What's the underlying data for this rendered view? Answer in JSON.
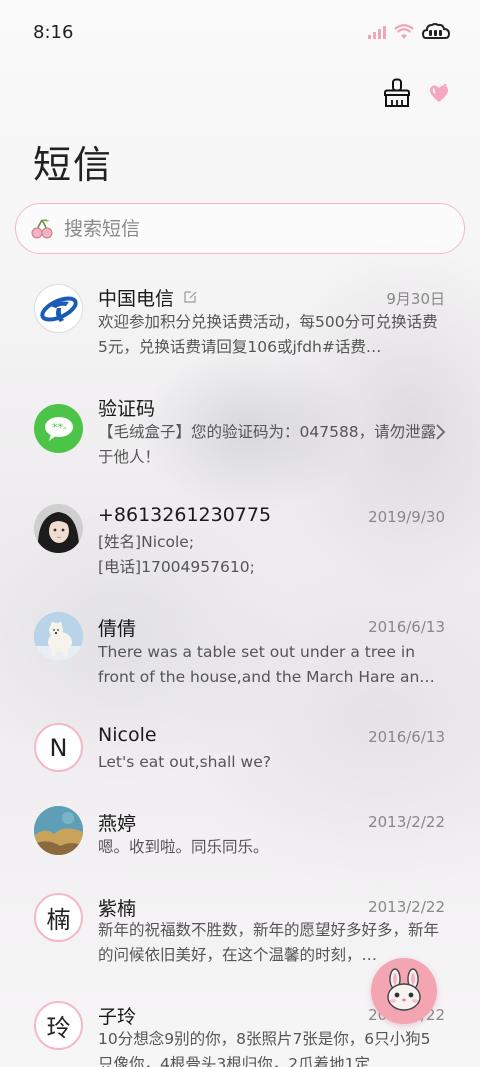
{
  "status_bar": {
    "time": "8:16",
    "accent": "#f2a6b4",
    "icons": [
      "signal-icon",
      "wifi-icon",
      "battery-icon"
    ]
  },
  "header": {
    "title": "短信",
    "actions": [
      "brush-icon",
      "heart-icon"
    ]
  },
  "search": {
    "placeholder": "搜索短信",
    "icon": "cherry-icon"
  },
  "conversations": [
    {
      "name": "中国电信",
      "date": "9月30日",
      "preview": "欢迎参加积分兑换话费活动，每500分可兑换话费5元，兑换话费请回复106或jfdh#话费…",
      "avatar": "china-telecom-logo",
      "badge": "edit-icon"
    },
    {
      "name": "验证码",
      "date": "",
      "preview": "【毛绒盒子】您的验证码为：047588，请勿泄露于他人！",
      "avatar": "message-bubble-icon"
    },
    {
      "name": "+8613261230775",
      "date": "2019/9/30",
      "preview": "[姓名]Nicole;\n[电话]17004957610;",
      "avatar": "photo-avatar-girl"
    },
    {
      "name": "倩倩",
      "date": "2016/6/13",
      "preview": "There was a table set out under a tree in front of the house,and the March Hare an…",
      "avatar": "photo-avatar-polar-bear"
    },
    {
      "name": "Nicole",
      "date": "2016/6/13",
      "preview": "Let's eat out,shall we?",
      "avatar_letter": "N"
    },
    {
      "name": "燕婷",
      "date": "2013/2/22",
      "preview": "嗯。收到啦。同乐同乐。",
      "avatar": "photo-avatar-landscape"
    },
    {
      "name": "紫楠",
      "date": "2013/2/22",
      "preview": "新年的祝福数不胜数，新年的愿望好多好多，新年的问候依旧美好，在这个温馨的时刻，…",
      "avatar_letter": "楠"
    },
    {
      "name": "子玲",
      "date": "2013/2/22",
      "preview": "10分想念9别的你，8张照片7张是你，6只小狗5只像你，4根骨头3根归你，2爪着地1定…",
      "avatar_letter": "玲"
    }
  ],
  "fab": {
    "icon": "bunny-icon",
    "color": "#f3a5b2"
  }
}
